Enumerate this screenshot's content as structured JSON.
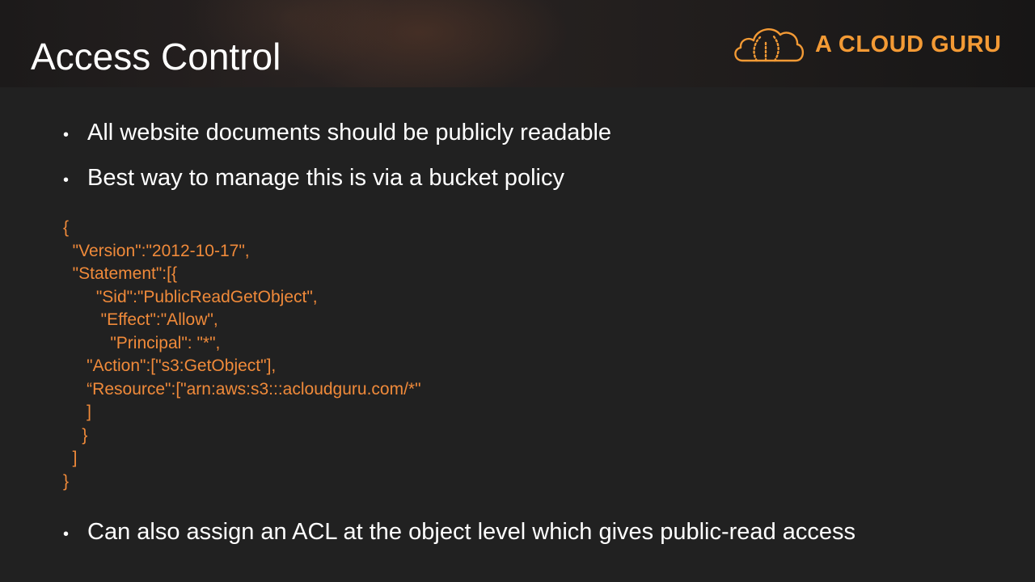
{
  "slide": {
    "title": "Access Control",
    "logo": {
      "text": "A CLOUD GURU",
      "icon": "cloud-guru-icon",
      "accent_color": "#f39a35"
    },
    "bullets": [
      "All website documents should be publicly readable",
      "Best way to manage this is via a bucket policy"
    ],
    "code_color": "#f08a3a",
    "code_lines": [
      "{",
      "  \"Version\":\"2012-10-17\",",
      "  \"Statement\":[{",
      "       \"Sid\":\"PublicReadGetObject\",",
      "        \"Effect\":\"Allow\",",
      "          \"Principal\": \"*\",",
      "     \"Action\":[\"s3:GetObject\"],",
      "     “Resource\":[\"arn:aws:s3:::acloudguru.com/*\"",
      "     ]",
      "    }",
      "  ]",
      "}"
    ],
    "final_bullet": "Can also assign an ACL at the object level which gives public-read access"
  }
}
